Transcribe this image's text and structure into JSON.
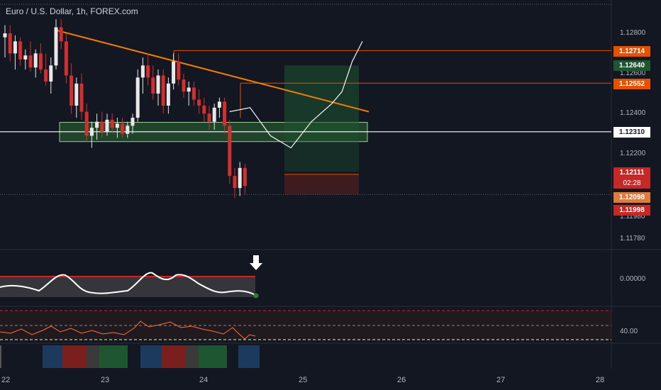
{
  "header": {
    "title": "Euro / U.S. Dollar, 1h, FOREX.com"
  },
  "price_axis": {
    "ticks": [
      "1.12800",
      "1.12600",
      "1.12400",
      "1.12200",
      "1.11980",
      "1.11780"
    ],
    "tags": [
      {
        "value": "1.12714",
        "bg": "#e65100",
        "fg": "#ffffff"
      },
      {
        "value": "1.12640",
        "bg": "#1e5631",
        "fg": "#ffffff"
      },
      {
        "value": "1.12552",
        "bg": "#e65100",
        "fg": "#ffffff"
      },
      {
        "value": "1.12310",
        "bg": "#ffffff",
        "fg": "#131722"
      },
      {
        "value": "1.12111",
        "bg": "#c62828",
        "fg": "#ffffff"
      },
      {
        "value": "1.12098",
        "bg": "#e07b39",
        "fg": "#ffffff"
      },
      {
        "value": "1.11998",
        "bg": "#c62828",
        "fg": "#ffffff"
      }
    ],
    "countdown": "02:28"
  },
  "oscillator": {
    "axis_label": "0.00000"
  },
  "rsi": {
    "axis_label": "40.00"
  },
  "time_axis": {
    "labels": [
      "22",
      "23",
      "24",
      "25",
      "26",
      "27",
      "28"
    ]
  },
  "colors": {
    "bull": "#e8e8e8",
    "bear": "#d32f2f",
    "trendline": "#f57c00",
    "support_zone": "#2e7d32",
    "background": "#131722"
  },
  "chart_data": {
    "type": "candlestick",
    "title": "Euro / U.S. Dollar, 1h, FOREX.com",
    "ylim": [
      1.1168,
      1.1288
    ],
    "x_labels": [
      "22",
      "23",
      "24",
      "25",
      "26",
      "27",
      "28"
    ],
    "key_levels": [
      1.12714,
      1.12552,
      1.1231,
      1.12111,
      1.12098,
      1.11998
    ],
    "support_zone": [
      1.12261,
      1.12357
    ],
    "trendline": [
      [
        0,
        1.1285
      ],
      [
        72,
        1.1241
      ]
    ],
    "candles": [
      [
        1.1278,
        1.1284,
        1.1268,
        1.128
      ],
      [
        1.128,
        1.1284,
        1.1266,
        1.127
      ],
      [
        1.127,
        1.1279,
        1.1262,
        1.1276
      ],
      [
        1.1276,
        1.1278,
        1.1264,
        1.1267
      ],
      [
        1.1267,
        1.1272,
        1.1262,
        1.1269
      ],
      [
        1.1269,
        1.1276,
        1.1261,
        1.1263
      ],
      [
        1.1263,
        1.1272,
        1.1258,
        1.127
      ],
      [
        1.127,
        1.1275,
        1.126,
        1.1262
      ],
      [
        1.1262,
        1.127,
        1.1254,
        1.1256
      ],
      [
        1.1256,
        1.1268,
        1.125,
        1.1264
      ],
      [
        1.1264,
        1.1287,
        1.1262,
        1.1283
      ],
      [
        1.1283,
        1.1287,
        1.1272,
        1.1276
      ],
      [
        1.1276,
        1.128,
        1.1255,
        1.1259
      ],
      [
        1.1259,
        1.1265,
        1.124,
        1.1244
      ],
      [
        1.1244,
        1.1258,
        1.1238,
        1.1255
      ],
      [
        1.1255,
        1.126,
        1.1237,
        1.1241
      ],
      [
        1.1241,
        1.1245,
        1.1226,
        1.1229
      ],
      [
        1.1229,
        1.1236,
        1.1223,
        1.1233
      ],
      [
        1.1233,
        1.124,
        1.1227,
        1.1236
      ],
      [
        1.1236,
        1.1241,
        1.1228,
        1.1231
      ],
      [
        1.1231,
        1.124,
        1.1229,
        1.1237
      ],
      [
        1.1237,
        1.124,
        1.123,
        1.1233
      ],
      [
        1.1233,
        1.1238,
        1.1228,
        1.1235
      ],
      [
        1.1235,
        1.1238,
        1.1228,
        1.123
      ],
      [
        1.123,
        1.1236,
        1.1228,
        1.1234
      ],
      [
        1.1234,
        1.124,
        1.123,
        1.1238
      ],
      [
        1.1238,
        1.1262,
        1.1236,
        1.1258
      ],
      [
        1.1258,
        1.1268,
        1.125,
        1.1264
      ],
      [
        1.1264,
        1.127,
        1.1254,
        1.1258
      ],
      [
        1.1258,
        1.1264,
        1.1247,
        1.125
      ],
      [
        1.125,
        1.1262,
        1.1244,
        1.1259
      ],
      [
        1.1259,
        1.1262,
        1.124,
        1.1244
      ],
      [
        1.1244,
        1.1258,
        1.124,
        1.1255
      ],
      [
        1.1255,
        1.127,
        1.1252,
        1.1266
      ],
      [
        1.1266,
        1.127,
        1.1254,
        1.1257
      ],
      [
        1.1257,
        1.126,
        1.1248,
        1.1251
      ],
      [
        1.1251,
        1.1256,
        1.1244,
        1.1253
      ],
      [
        1.1253,
        1.1256,
        1.1244,
        1.1247
      ],
      [
        1.1247,
        1.1252,
        1.124,
        1.1244
      ],
      [
        1.1244,
        1.1248,
        1.1236,
        1.124
      ],
      [
        1.124,
        1.1244,
        1.1232,
        1.1236
      ],
      [
        1.1236,
        1.1245,
        1.1232,
        1.1243
      ],
      [
        1.1243,
        1.1248,
        1.1238,
        1.1246
      ],
      [
        1.1246,
        1.1248,
        1.123,
        1.1234
      ],
      [
        1.1234,
        1.1237,
        1.1205,
        1.1209
      ],
      [
        1.1209,
        1.1213,
        1.1198,
        1.1203
      ],
      [
        1.1203,
        1.1216,
        1.1199,
        1.1213
      ],
      [
        1.1213,
        1.1215,
        1.12,
        1.1204
      ]
    ],
    "projection": [
      [
        44,
        1.1241
      ],
      [
        48,
        1.1243
      ],
      [
        52,
        1.1229
      ],
      [
        56,
        1.1223
      ],
      [
        60,
        1.1236
      ],
      [
        64,
        1.1245
      ],
      [
        66,
        1.1251
      ],
      [
        68,
        1.1266
      ],
      [
        70,
        1.1276
      ]
    ]
  }
}
